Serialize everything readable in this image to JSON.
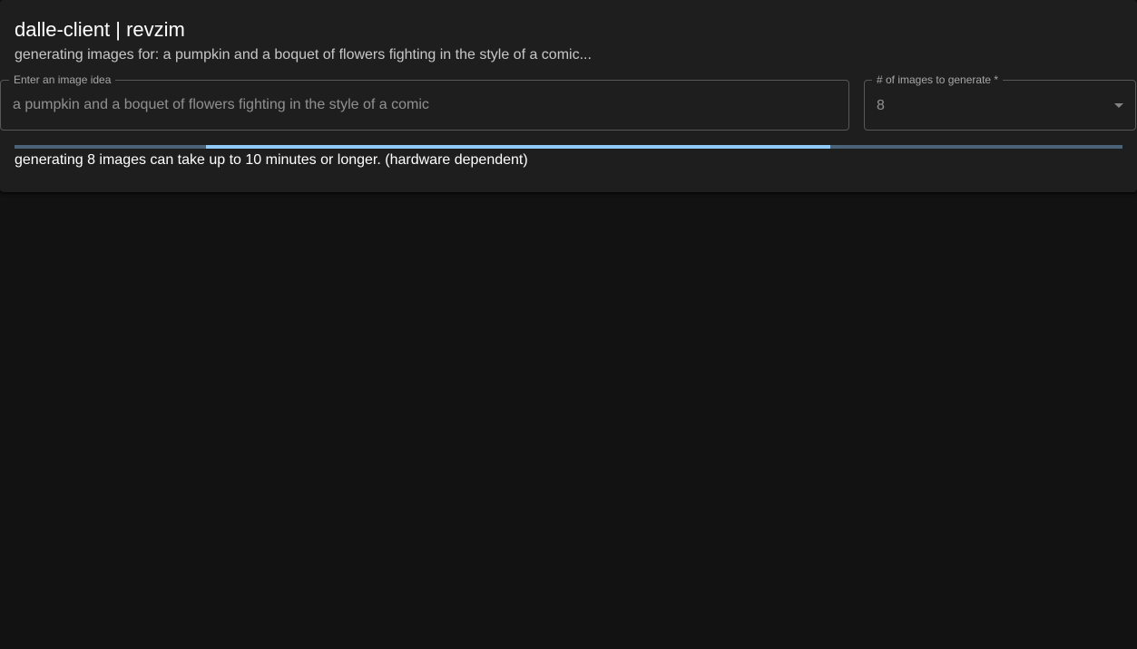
{
  "app": {
    "title": "dalle-client | revzim",
    "status_text": "generating images for: a pumpkin and a boquet of flowers fighting in the style of a comic..."
  },
  "prompt_field": {
    "label": "Enter an image idea",
    "value": "a pumpkin and a boquet of flowers fighting in the style of a comic"
  },
  "count_field": {
    "label": "# of images to generate *",
    "selected_value": "8"
  },
  "progress": {
    "mode": "indeterminate",
    "track_color": "#4a6378",
    "bar_color": "#90caf9"
  },
  "notice": "generating 8 images can take up to 10 minutes or longer. (hardware dependent)",
  "colors": {
    "background": "#121212",
    "card": "#1e1e1e",
    "accent": "#90caf9"
  }
}
